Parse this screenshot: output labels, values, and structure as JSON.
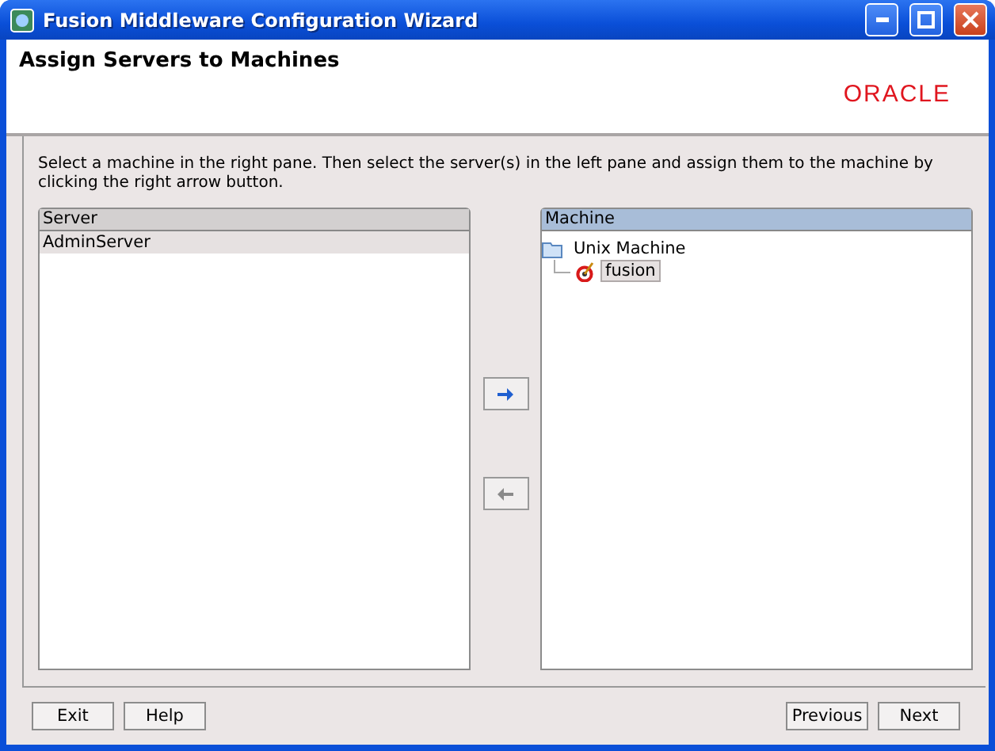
{
  "window": {
    "title": "Fusion Middleware Configuration Wizard"
  },
  "header": {
    "title": "Assign Servers to Machines",
    "logo": "ORACLE"
  },
  "instructions": "Select a machine in the right pane. Then select the server(s) in the left pane and assign them to the machine by clicking the right arrow button.",
  "server_pane": {
    "heading": "Server",
    "rows": [
      {
        "label": "AdminServer",
        "selected": true
      }
    ]
  },
  "assign_buttons": [
    {
      "kind": "right",
      "disabled": false
    },
    {
      "kind": "left",
      "disabled": true
    }
  ],
  "machine_pane": {
    "heading": "Machine",
    "tree": [
      {
        "label": "Unix Machine",
        "kind": "folder",
        "selected": false,
        "children": [
          {
            "label": "fusion",
            "kind": "machine",
            "selected": true
          }
        ]
      }
    ]
  },
  "footer": {
    "left_buttons": [
      "Exit",
      "Help"
    ],
    "right_buttons": [
      "Previous",
      "Next"
    ]
  }
}
